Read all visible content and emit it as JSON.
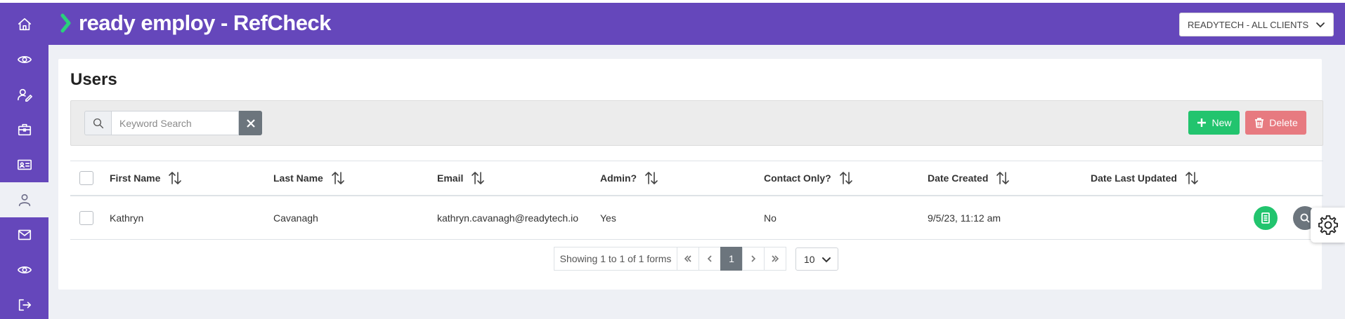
{
  "app": {
    "title": "ready employ - RefCheck",
    "brand_color": "#6547bb",
    "client_selector": "READYTECH - ALL CLIENTS"
  },
  "sidebar": {
    "items": [
      {
        "name": "home",
        "icon": "home-icon"
      },
      {
        "name": "view",
        "icon": "eye-icon"
      },
      {
        "name": "referee",
        "icon": "user-edit-icon"
      },
      {
        "name": "jobs",
        "icon": "briefcase-icon"
      },
      {
        "name": "candidates",
        "icon": "id-card-icon"
      },
      {
        "name": "users",
        "icon": "user-icon",
        "active": true
      },
      {
        "name": "messages",
        "icon": "mail-icon"
      },
      {
        "name": "preview",
        "icon": "eye-icon"
      },
      {
        "name": "logout",
        "icon": "logout-icon"
      }
    ]
  },
  "page": {
    "title": "Users",
    "search_placeholder": "Keyword Search",
    "new_label": "New",
    "delete_label": "Delete",
    "new_color": "#22c46e",
    "delete_color": "#e77a80"
  },
  "table": {
    "columns": [
      "First Name",
      "Last Name",
      "Email",
      "Admin?",
      "Contact Only?",
      "Date Created",
      "Date Last Updated"
    ],
    "rows": [
      {
        "first_name": "Kathryn",
        "last_name": "Cavanagh",
        "email": "kathryn.cavanagh@readytech.io",
        "admin": "Yes",
        "contact_only": "No",
        "date_created": "9/5/23, 11:12 am",
        "date_last_updated": ""
      }
    ]
  },
  "pagination": {
    "info": "Showing 1 to 1 of 1 forms",
    "current_page": "1",
    "page_size": "10"
  }
}
